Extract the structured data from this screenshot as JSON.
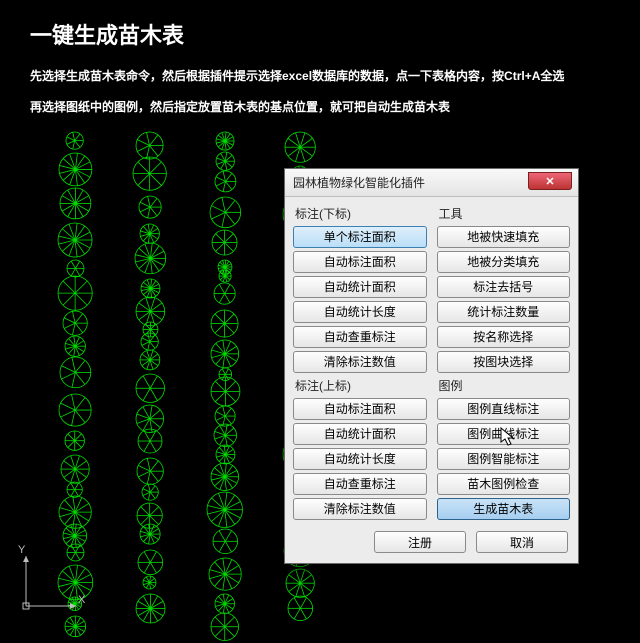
{
  "page": {
    "title": "一键生成苗木表",
    "instruction1": "先选择生成苗木表命令，然后根据插件提示选择excel数据库的数据，点一下表格内容，按Ctrl+A全选",
    "instruction2": "再选择图纸中的图例，然后指定放置苗木表的基点位置，就可把自动生成苗木表"
  },
  "ucs": {
    "x": "X",
    "y": "Y"
  },
  "dialog": {
    "title": "园林植物绿化智能化插件",
    "groups": {
      "lower_label": "标注(下标)",
      "upper_label": "标注(上标)",
      "tools_label": "工具",
      "legend_label": "图例"
    },
    "lower": [
      "单个标注面积",
      "自动标注面积",
      "自动统计面积",
      "自动统计长度",
      "自动查重标注",
      "清除标注数值"
    ],
    "upper": [
      "自动标注面积",
      "自动统计面积",
      "自动统计长度",
      "自动查重标注",
      "清除标注数值"
    ],
    "tools": [
      "地被快速填充",
      "地被分类填充",
      "标注去括号",
      "统计标注数量",
      "按名称选择",
      "按图块选择"
    ],
    "legend": [
      "图例直线标注",
      "图例曲线标注",
      "图例智能标注",
      "苗木图例检查",
      "生成苗木表"
    ],
    "footer": {
      "register": "注册",
      "cancel": "取消"
    }
  }
}
